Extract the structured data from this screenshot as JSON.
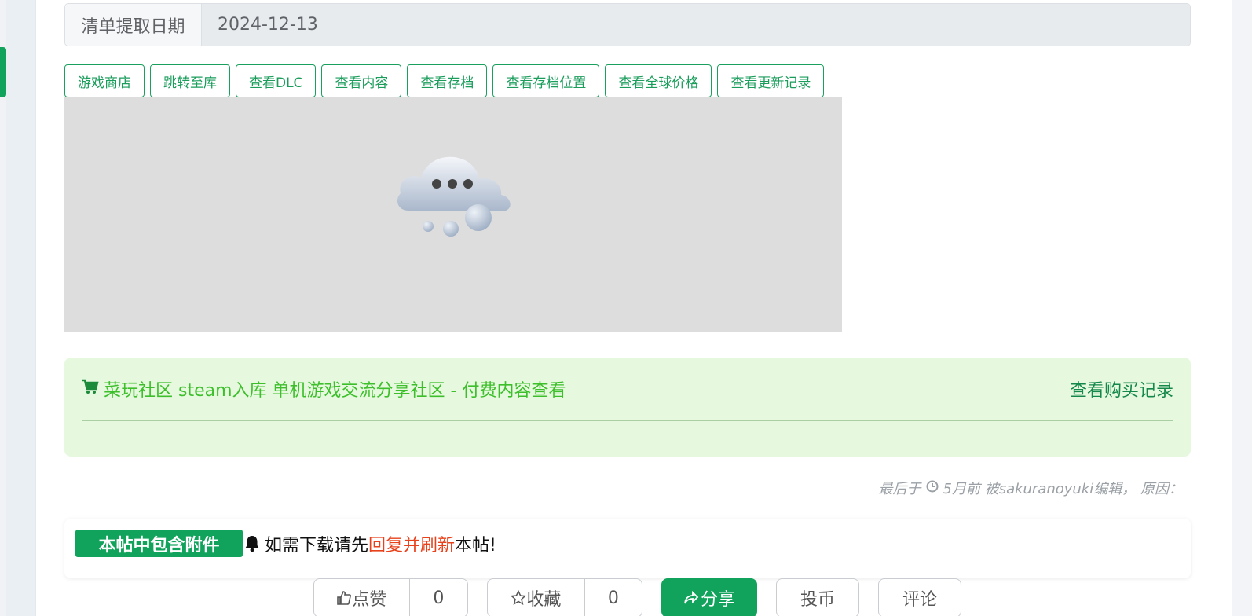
{
  "date_row": {
    "label": "清单提取日期",
    "value": "2024-12-13"
  },
  "toolbar": {
    "buttons": [
      "游戏商店",
      "跳转至库",
      "查看DLC",
      "查看内容",
      "查看存档",
      "查看存档位置",
      "查看全球价格",
      "查看更新记录"
    ]
  },
  "image_placeholder": {
    "icon": "loading-cloud-icon"
  },
  "paid_section": {
    "icon": "cart-icon",
    "title": "菜玩社区 steam入库 单机游戏交流分享社区 - 付费内容查看",
    "record_link": "查看购买记录"
  },
  "edit_note": {
    "prefix": "最后于",
    "icon": "clock-icon",
    "text": "5月前 被sakuranoyuki编辑， 原因："
  },
  "attachment": {
    "badge": "本帖中包含附件",
    "icon": "bell-icon",
    "text_before": "如需下载请先",
    "text_highlight": "回复并刷新",
    "text_after": "本帖!"
  },
  "actions": {
    "like_label": "点赞",
    "like_count": "0",
    "fav_label": "收藏",
    "fav_count": "0",
    "share_label": "分享",
    "coin_label": "投币",
    "comment_label": "评论"
  },
  "colors": {
    "brand_green": "#11a35c",
    "highlight_red": "#e8421c"
  }
}
